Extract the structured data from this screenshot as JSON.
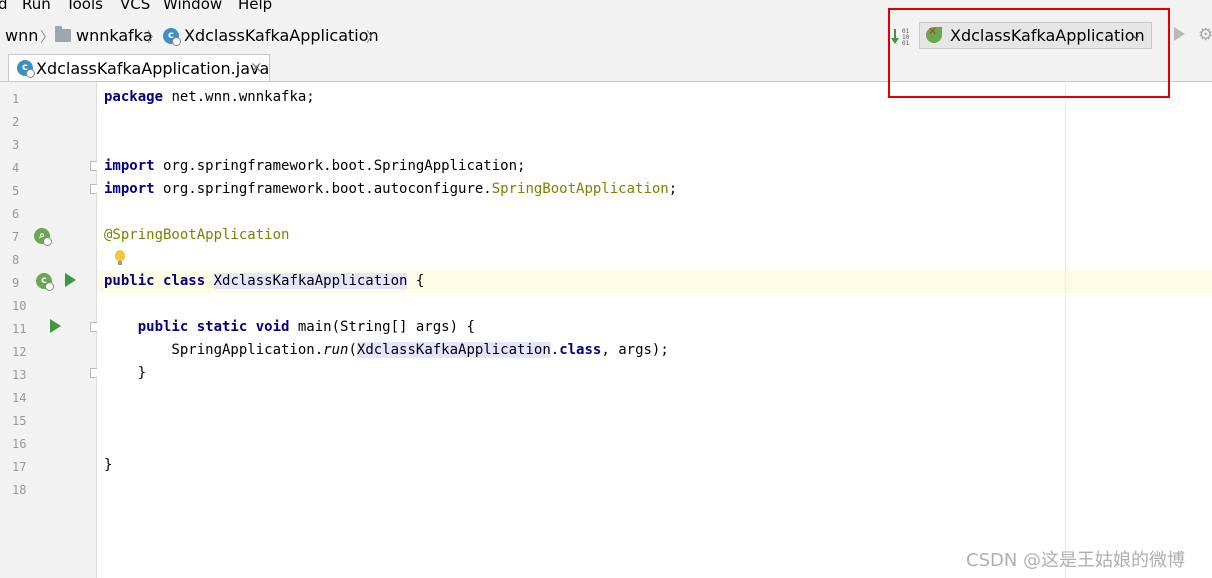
{
  "menu": [
    {
      "label": "d"
    },
    {
      "label": "Run"
    },
    {
      "label": "Tools"
    },
    {
      "label": "VCS"
    },
    {
      "label": "Window"
    },
    {
      "label": "Help"
    }
  ],
  "breadcrumb": [
    "wnn",
    "wnnkafka",
    "XdclassKafkaApplication"
  ],
  "run_config": {
    "label": "XdclassKafkaApplication"
  },
  "tab": {
    "label": "XdclassKafkaApplication.java",
    "close": "×"
  },
  "icons": {
    "folder": "folder-icon",
    "class": "spring-class-icon",
    "sort": "sort-icon",
    "run": "run-icon",
    "settings": "gear-icon"
  },
  "line_numbers": [
    "1",
    "2",
    "3",
    "4",
    "5",
    "6",
    "7",
    "8",
    "9",
    "10",
    "11",
    "12",
    "13",
    "14",
    "15",
    "16",
    "17",
    "18"
  ],
  "code": {
    "l1_kw": "package",
    "l1_rest": " net.wnn.wnnkafka;",
    "l4_kw": "import",
    "l4_rest": " org.springframework.boot.SpringApplication;",
    "l5_kw": "import",
    "l5_rest": " org.springframework.boot.autoconfigure.",
    "l5_anno": "SpringBootApplication",
    "l5_end": ";",
    "l7_anno": "@SpringBootApplication",
    "l9_kw": "public class",
    "l9_sp": " ",
    "l9_cls": "XdclassKafkaApplication",
    "l9_end": " {",
    "l11_indent": "    ",
    "l11_kw": "public static void",
    "l11_rest": " main(String[] args) {",
    "l12_a": "        SpringApplication.",
    "l12_run": "run",
    "l12_b": "(",
    "l12_cls": "XdclassKafkaApplication",
    "l12_c": ".",
    "l12_kw": "class",
    "l12_d": ", args);",
    "l13": "    }",
    "l17": "}"
  },
  "watermark": "CSDN @这是王姑娘的微博",
  "colors": {
    "keyword": "#000080",
    "annotation": "#808000",
    "highlight_box": "#e00000",
    "run_green": "#3c9a3c"
  }
}
